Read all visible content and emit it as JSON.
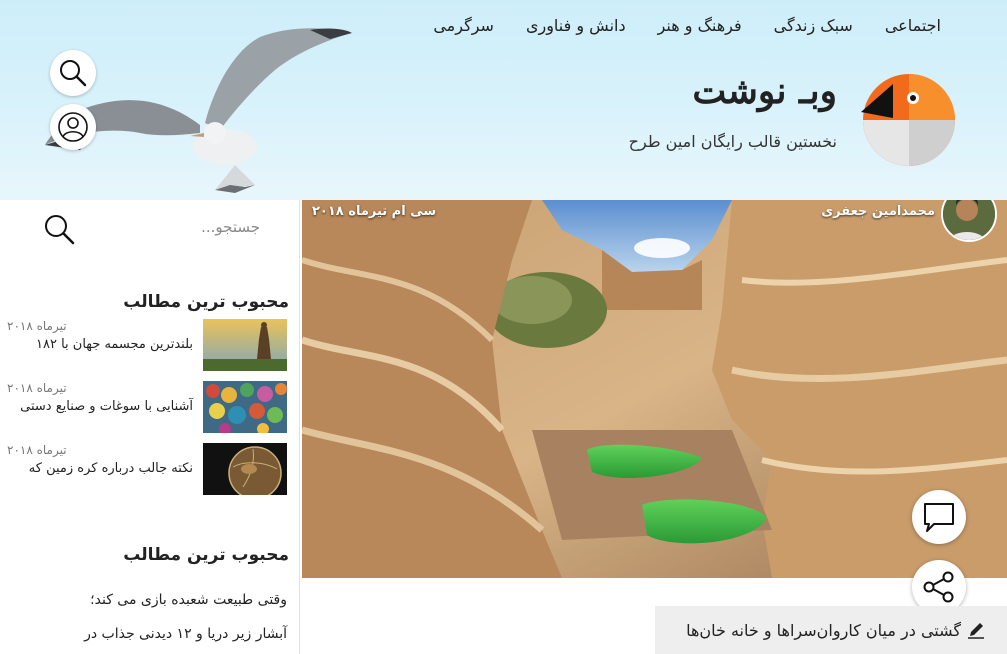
{
  "nav": {
    "items": [
      "اجتماعی",
      "سبک زندگی",
      "فرهنگ و هنر",
      "دانش و فناوری",
      "سرگرمی"
    ]
  },
  "site": {
    "title": "وبـ نوشت",
    "subtitle": "نخستین قالب رایگان امین طرح"
  },
  "sidebar": {
    "search_placeholder": "جستجو...",
    "popular_title": "محبوب ترین مطالب",
    "popular_items": [
      {
        "title": "بلندترین مجسمه جهان با ۱۸۲",
        "date": "تیرماه ۲۰۱۸"
      },
      {
        "title": "آشنایی با سوغات و صنایع دستی",
        "date": "تیرماه ۲۰۱۸"
      },
      {
        "title": "نکته جالب درباره کره زمین که",
        "date": "تیرماه ۲۰۱۸"
      }
    ],
    "popular2_title": "محبوب ترین مطالب",
    "text_items": [
      "وقتی طبیعت شعبده بازی می کند؛",
      "آبشار زیر دریا و ۱۲ دیدنی جذاب در"
    ]
  },
  "post": {
    "author": "محمدامین جعفری",
    "date": "سی ام تیرماه ۲۰۱۸",
    "title": "گشتی در میان کاروان‌سراها و خانه خان‌ها"
  },
  "icons": {
    "header_search": "search-icon",
    "header_user": "user-icon",
    "sidebar_search": "search-icon",
    "comment": "comment-icon",
    "share": "share-icon",
    "pencil": "pencil-icon"
  },
  "colors": {
    "header_bg": "#cdeef9",
    "logo_orange": "#f26a1b",
    "title_bar_bg": "#eeeeee",
    "water_green": "#3fbf3a"
  }
}
